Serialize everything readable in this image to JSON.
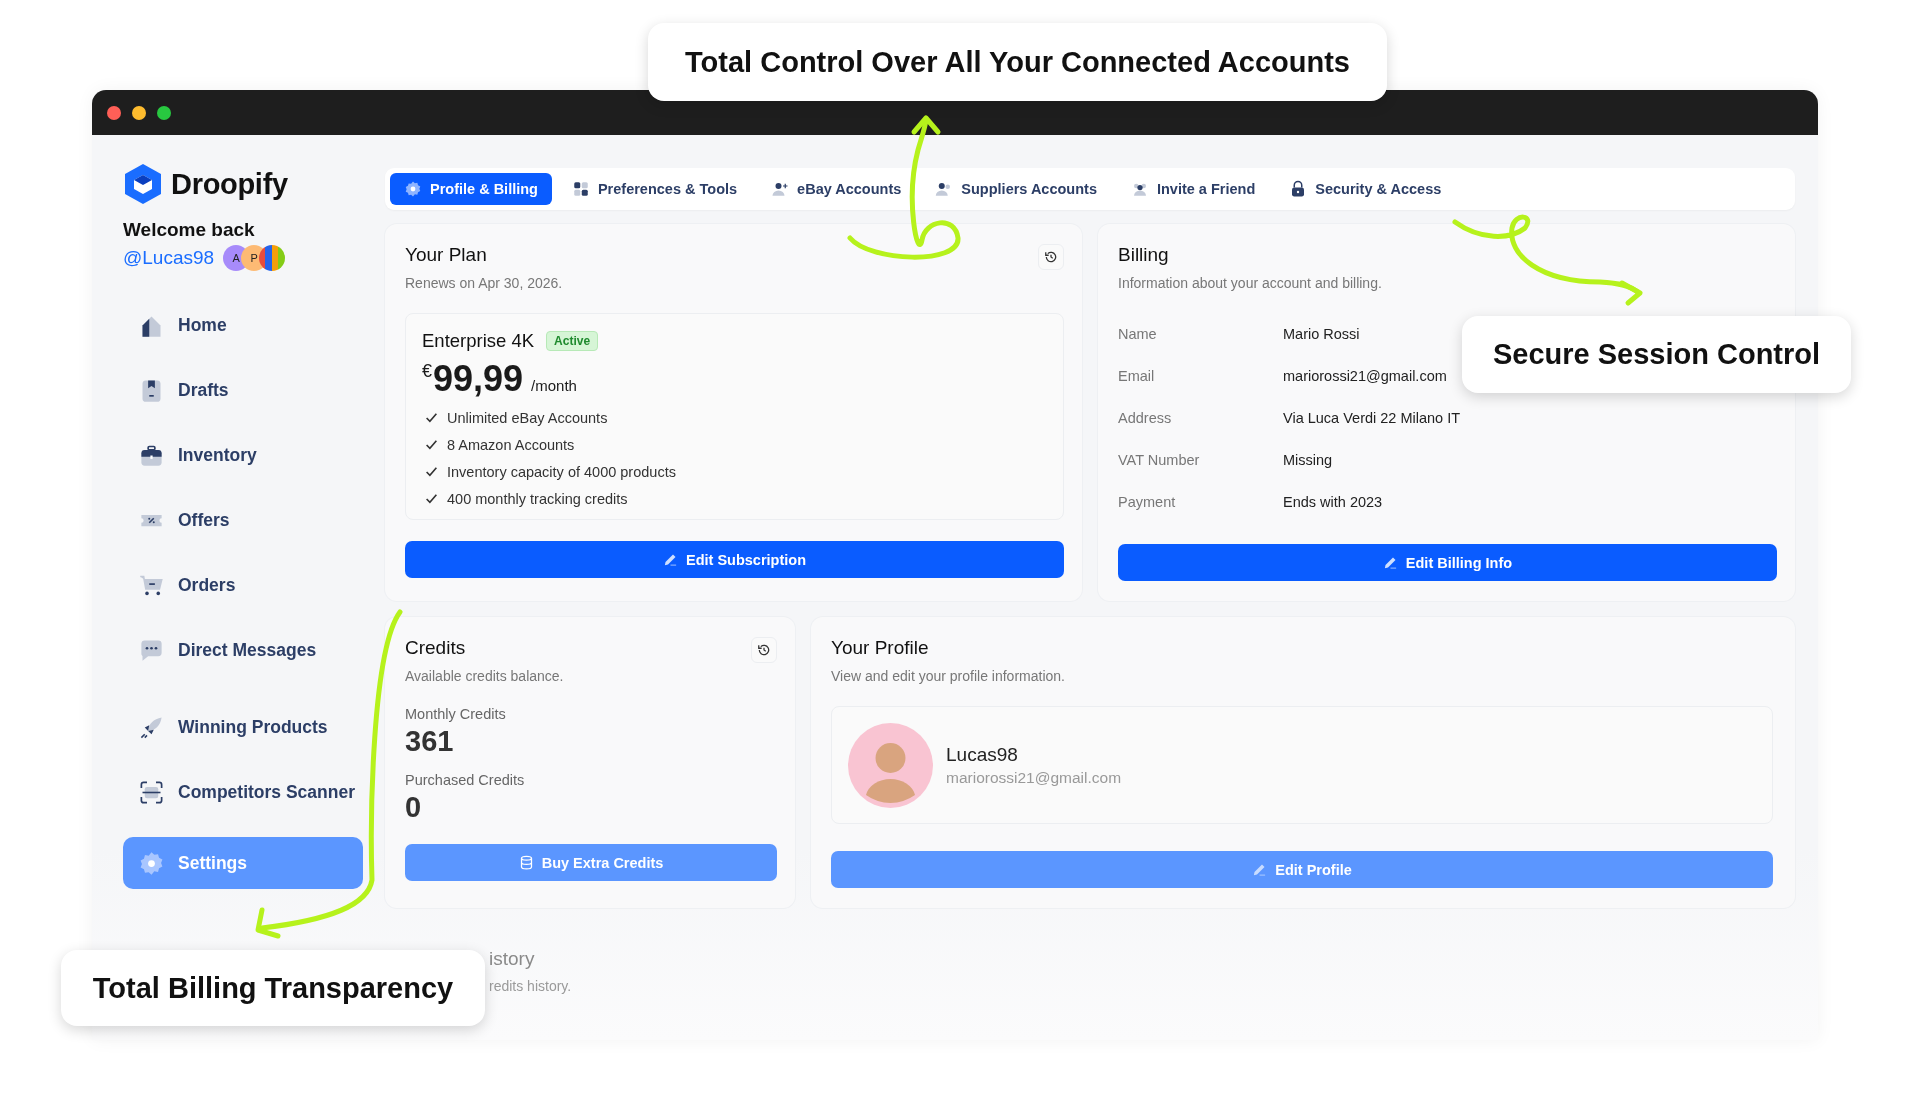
{
  "callouts": [
    {
      "text": "Total Control Over All Your Connected Accounts"
    },
    {
      "text": "Secure Session Control"
    },
    {
      "text": "Total Billing Transparency"
    }
  ],
  "sidebar": {
    "brand": "Droopify",
    "welcome": "Welcome back",
    "username": "@Lucas98",
    "avatars": [
      {
        "initial": "A",
        "color": "#a78bfa"
      },
      {
        "initial": "P",
        "color": "#fdba74"
      }
    ],
    "items": [
      {
        "label": "Home",
        "selected": false
      },
      {
        "label": "Drafts",
        "selected": false
      },
      {
        "label": "Inventory",
        "selected": false
      },
      {
        "label": "Offers",
        "selected": false
      },
      {
        "label": "Orders",
        "selected": false
      },
      {
        "label": "Direct Messages",
        "selected": false
      },
      {
        "label": "Winning Products",
        "selected": false
      },
      {
        "label": "Competitors Scanner",
        "selected": false
      },
      {
        "label": "Settings",
        "selected": true
      }
    ]
  },
  "tabs": [
    {
      "label": "Profile & Billing",
      "selected": true
    },
    {
      "label": "Preferences & Tools",
      "selected": false
    },
    {
      "label": "eBay Accounts",
      "selected": false
    },
    {
      "label": "Suppliers Accounts",
      "selected": false
    },
    {
      "label": "Invite a Friend",
      "selected": false
    },
    {
      "label": "Security & Access",
      "selected": false
    }
  ],
  "plan": {
    "title": "Your Plan",
    "subtitle": "Renews on Apr 30, 2026.",
    "name": "Enterprise 4K",
    "badge": "Active",
    "currency": "€",
    "price": "99,99",
    "period": "/month",
    "features": [
      "Unlimited eBay Accounts",
      "8 Amazon Accounts",
      "Inventory capacity of 4000 products",
      "400 monthly tracking credits"
    ],
    "button": "Edit Subscription"
  },
  "billing": {
    "title": "Billing",
    "subtitle": "Information about your account and billing.",
    "fields": [
      {
        "label": "Name",
        "value": "Mario Rossi"
      },
      {
        "label": "Email",
        "value": "mariorossi21@gmail.com"
      },
      {
        "label": "Address",
        "value": "Via Luca Verdi 22 Milano IT"
      },
      {
        "label": "VAT Number",
        "value": "Missing"
      },
      {
        "label": "Payment",
        "value": "Ends with 2023"
      }
    ],
    "button": "Edit Billing Info"
  },
  "credits": {
    "title": "Credits",
    "subtitle": "Available credits balance.",
    "monthly_label": "Monthly Credits",
    "monthly_value": "361",
    "purchased_label": "Purchased Credits",
    "purchased_value": "0",
    "button": "Buy Extra Credits"
  },
  "profile": {
    "title": "Your Profile",
    "subtitle": "View and edit your profile information.",
    "username": "Lucas98",
    "email": "mariorossi21@gmail.com",
    "button": "Edit Profile"
  },
  "history": {
    "title": "istory",
    "subtitle": "redits history."
  }
}
